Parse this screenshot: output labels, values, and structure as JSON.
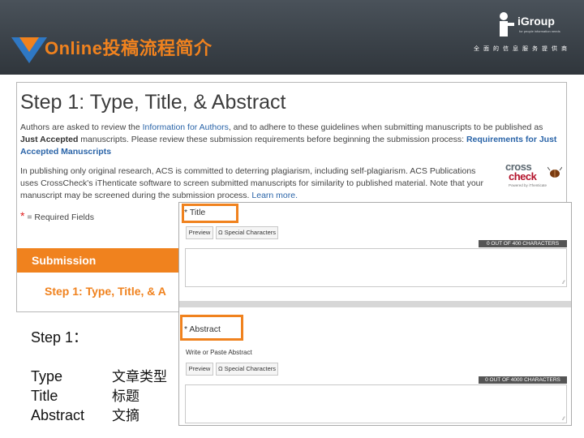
{
  "slide": {
    "title": "Online投稿流程简介",
    "brand_name": "iGroup",
    "brand_subtitle": "for people information needs",
    "brand_tagline": "全面的信息服务提供商"
  },
  "acs_page": {
    "heading": "Step 1: Type, Title, & Abstract",
    "para1_a": "Authors are asked to review the ",
    "para1_link": "Information for Authors",
    "para1_b": ", and to adhere to these guidelines when submitting manuscripts to be published as ",
    "para1_bold": "Just Accepted",
    "para1_c": " manuscripts. Please review these submission requirements before beginning the submission process: ",
    "para1_link2": "Requirements for Just Accepted Manuscripts",
    "para2_a": "In publishing only original research, ACS is committed to deterring plagiarism, including self-plagiarism. ACS Publications uses CrossCheck's iThenticate software to screen submitted manuscripts for similarity to published material. Note that your manuscript may be screened during the submission process. ",
    "para2_link": "Learn more.",
    "required_star": "*",
    "required_text": " = Required Fields",
    "crosscheck_line1": "cross",
    "crosscheck_line2": "check",
    "crosscheck_by": "Powered by iThenticate",
    "submission_label": "Submission",
    "submission_step": "Step 1: Type, Title, & A"
  },
  "form": {
    "title_label": "* Title",
    "preview_label": "Preview",
    "special_chars_label": "Ω Special Characters",
    "title_counter": "0 OUT OF 400 CHARACTERS",
    "abstract_label": "* Abstract",
    "write_paste": "Write or Paste Abstract",
    "abstract_counter": "0 OUT OF 4000 CHARACTERS",
    "resize_glyph": "⁄⁄"
  },
  "explanation": {
    "step": "Step 1：",
    "rows": [
      {
        "en": "Type",
        "zh": "文章类型"
      },
      {
        "en": "Title",
        "zh": "标题"
      },
      {
        "en": "Abstract",
        "zh": "文摘"
      }
    ]
  },
  "colors": {
    "accent_orange": "#f0821e",
    "header_gray": "#3b4249",
    "logo_blue": "#2f78c4",
    "link_blue": "#2a64a8"
  }
}
